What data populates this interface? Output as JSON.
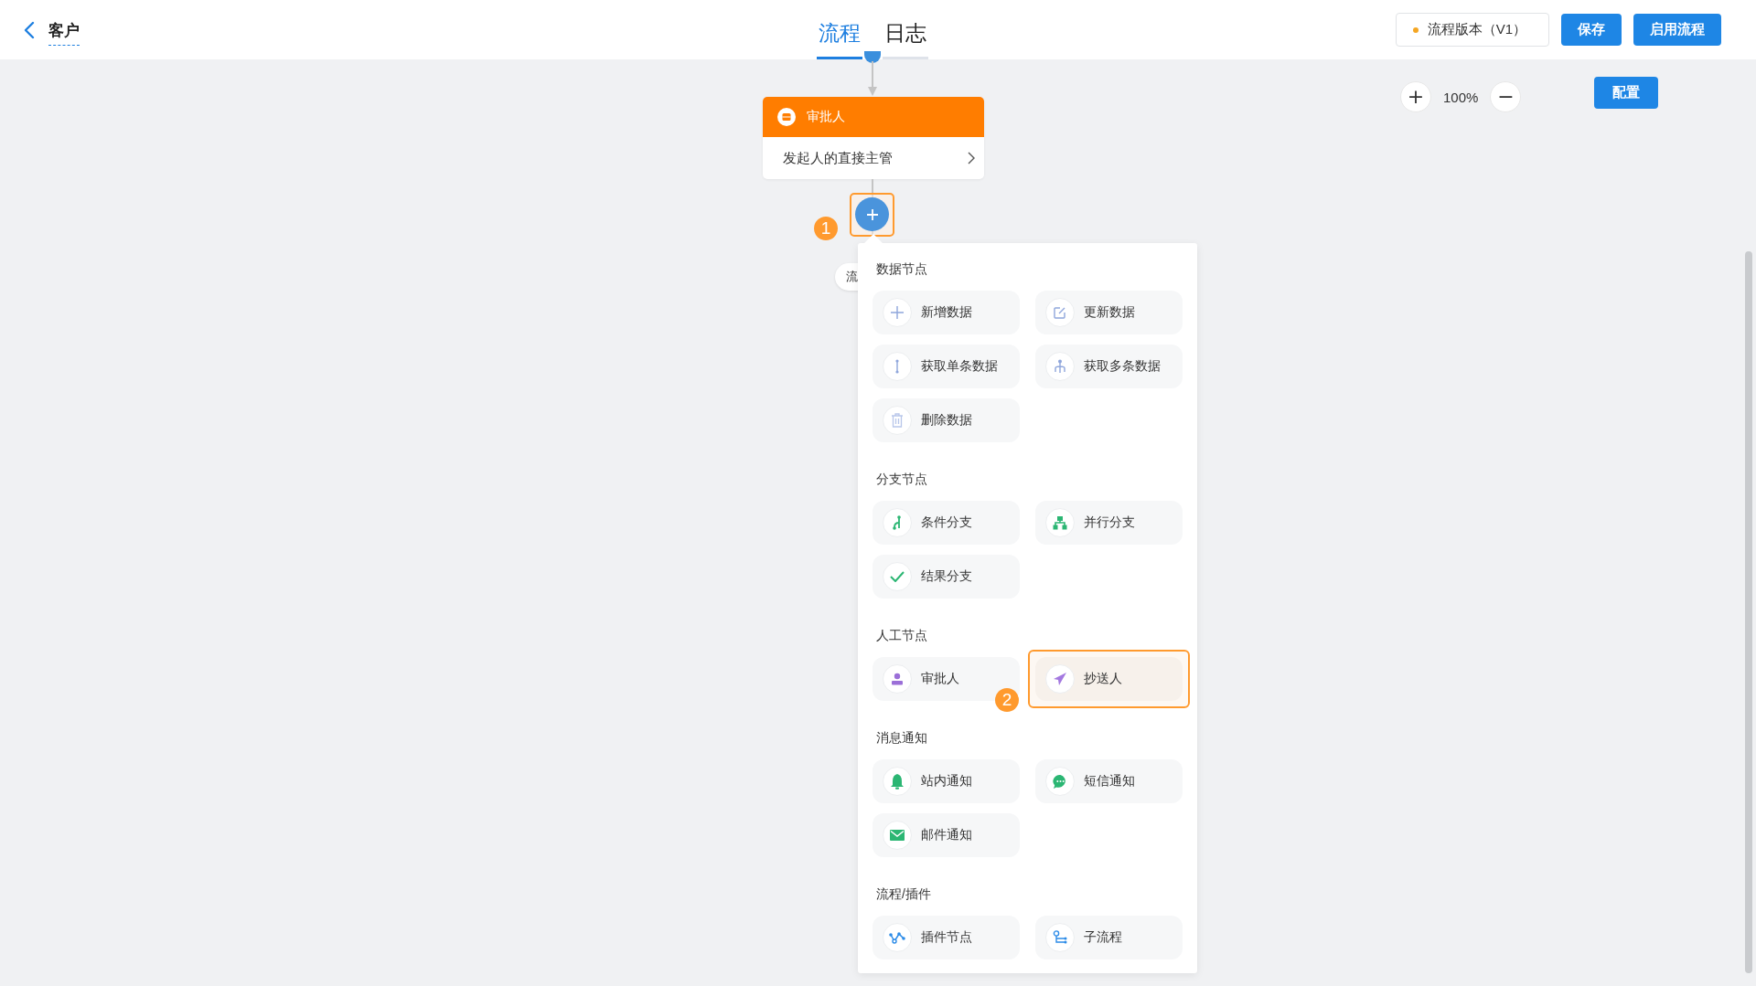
{
  "header": {
    "back_label": "客户",
    "tabs": [
      {
        "label": "流程",
        "selected": true
      },
      {
        "label": "日志",
        "selected": false
      }
    ],
    "version_label": "流程版本（V1）",
    "buttons": [
      "保存",
      "启用流程"
    ]
  },
  "zoom": {
    "plus": "+",
    "value": "100%",
    "minus": "−"
  },
  "config_button": "配置",
  "node": {
    "title": "审批人",
    "summary": "发起人的直接主管"
  },
  "step_markers": [
    "1",
    "2"
  ],
  "hidden_chip": "流",
  "menu": {
    "sections": [
      {
        "title": "数据节点",
        "items": [
          {
            "label": "新增数据",
            "kind": "plus",
            "selected": false
          },
          {
            "label": "更新数据",
            "kind": "edit",
            "selected": false
          },
          {
            "label": "获取单条数据",
            "kind": "single",
            "selected": false
          },
          {
            "label": "获取多条数据",
            "kind": "multi",
            "selected": false
          },
          {
            "label": "删除数据",
            "kind": "trash",
            "selected": false
          }
        ]
      },
      {
        "title": "分支节点",
        "items": [
          {
            "label": "条件分支",
            "kind": "condition",
            "selected": false
          },
          {
            "label": "并行分支",
            "kind": "parallel",
            "selected": false
          },
          {
            "label": "结果分支",
            "kind": "check",
            "selected": false
          }
        ]
      },
      {
        "title": "人工节点",
        "items": [
          {
            "label": "审批人",
            "kind": "person",
            "selected": false
          },
          {
            "label": "抄送人",
            "kind": "send",
            "selected": true
          }
        ]
      },
      {
        "title": "消息通知",
        "items": [
          {
            "label": "站内通知",
            "kind": "bell",
            "selected": false
          },
          {
            "label": "短信通知",
            "kind": "chat",
            "selected": false
          },
          {
            "label": "邮件通知",
            "kind": "mail",
            "selected": false
          }
        ]
      },
      {
        "title": "流程/插件",
        "items": [
          {
            "label": "插件节点",
            "kind": "plugin",
            "selected": false
          },
          {
            "label": "子流程",
            "kind": "subflow",
            "selected": false
          }
        ]
      }
    ]
  }
}
